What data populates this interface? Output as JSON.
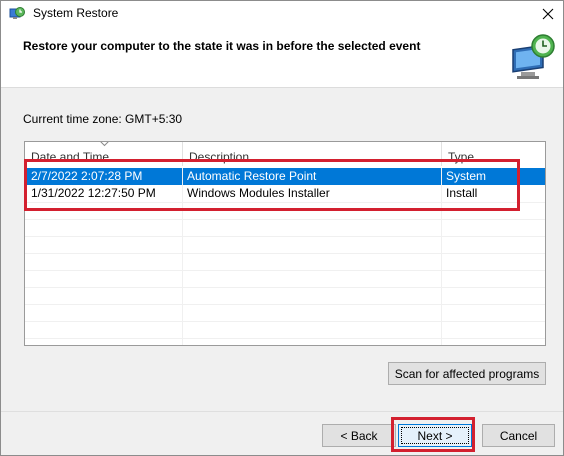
{
  "window": {
    "title": "System Restore"
  },
  "header": {
    "text": "Restore your computer to the state it was in before the selected event"
  },
  "timezone_label": "Current time zone: GMT+5:30",
  "list": {
    "columns": [
      "Date and Time",
      "Description",
      "Type"
    ],
    "rows": [
      {
        "date": "2/7/2022 2:07:28 PM",
        "description": "Automatic Restore Point",
        "type": "System",
        "selected": true
      },
      {
        "date": "1/31/2022 12:27:50 PM",
        "description": "Windows Modules Installer",
        "type": "Install",
        "selected": false
      }
    ]
  },
  "buttons": {
    "scan": "Scan for affected programs",
    "back": "< Back",
    "next": "Next >",
    "cancel": "Cancel"
  },
  "icons": {
    "title": "system-restore-icon",
    "close": "close-icon",
    "header": "restore-clock-icon"
  },
  "colors": {
    "selection": "#0078d7",
    "annotation": "#d3202f"
  }
}
